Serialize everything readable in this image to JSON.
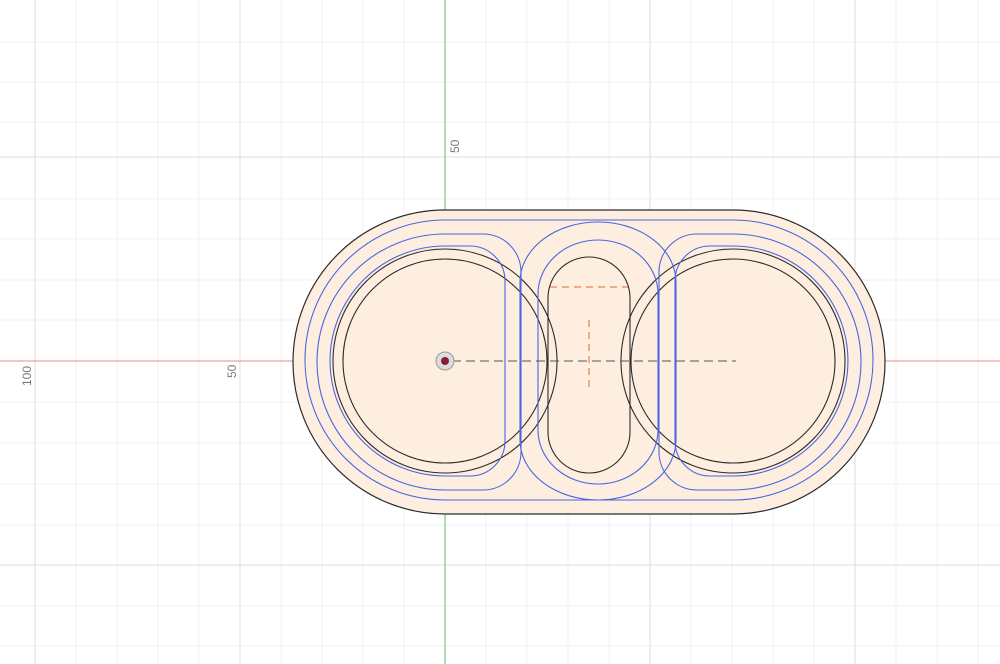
{
  "canvas": {
    "background": "#ffffff",
    "grid_minor_color": "#f1f1f1",
    "grid_major_color": "#dedede",
    "x_axis_color": "#f0a0a0",
    "y_axis_color": "#7ec47e"
  },
  "axis_labels": {
    "y_positive": "50",
    "x_negative_near": "50",
    "x_negative_far": "100"
  },
  "sketch": {
    "profile_fill": "#fdeee0",
    "outline_color": "#2b2b2b",
    "offset_curve_color": "#4a66e0",
    "construction_color": "#e06a3a",
    "centerline_color": "#555555",
    "origin_point_color": "#8b1a3a",
    "origin_icon": "origin-point-icon"
  }
}
